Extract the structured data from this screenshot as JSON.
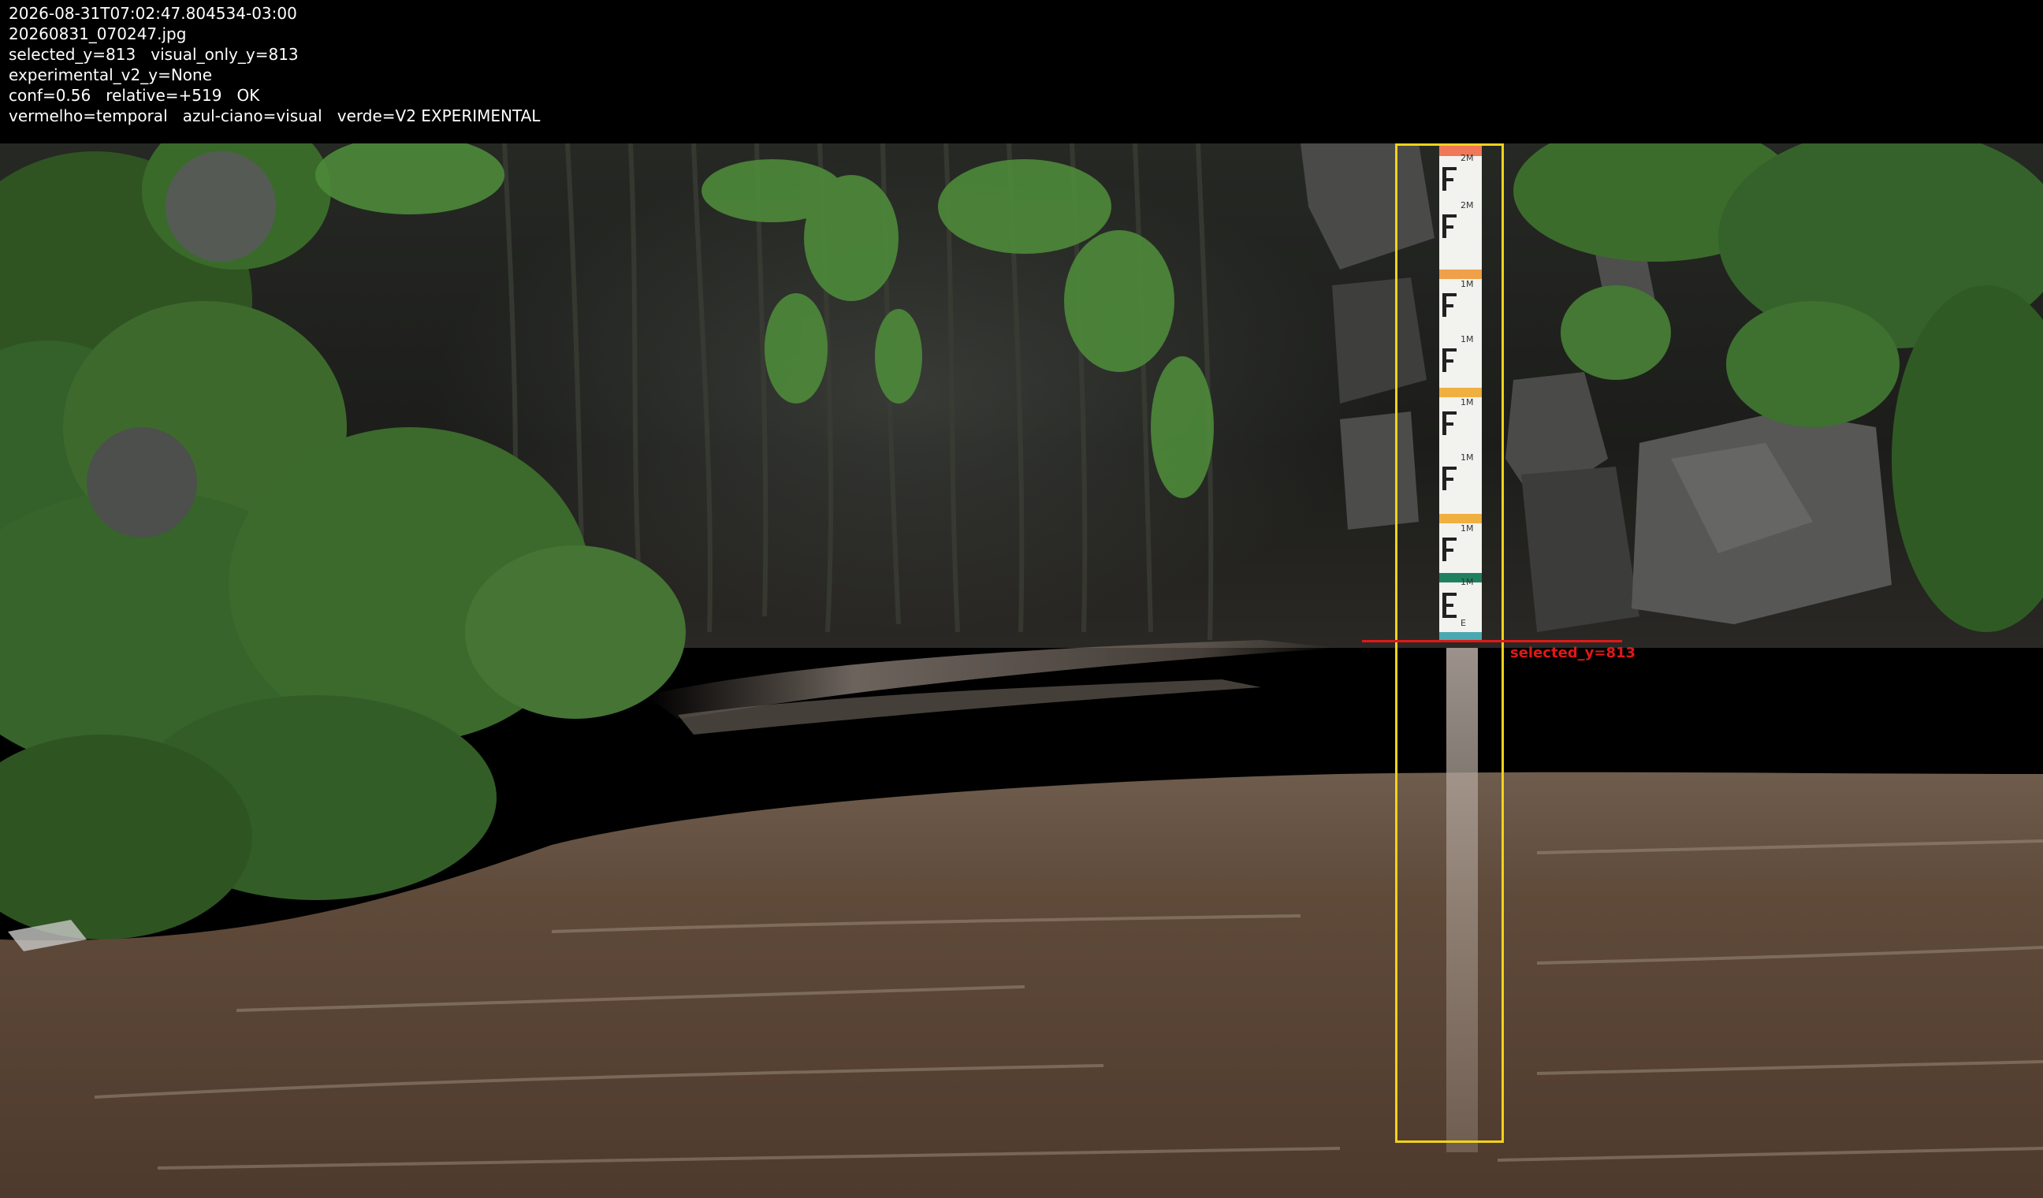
{
  "overlay": {
    "lines": [
      "2026-08-31T07:02:47.804534-03:00",
      "20260831_070247.jpg",
      "selected_y=813   visual_only_y=813",
      "experimental_v2_y=None",
      "conf=0.56   relative=+519   OK",
      "vermelho=temporal   azul-ciano=visual   verde=V2 EXPERIMENTAL"
    ]
  },
  "annotations": {
    "waterline_label": "selected_y=813",
    "roi_color": "#f2d21a",
    "waterline_color": "#e01818"
  },
  "staff_gauge": {
    "markings": [
      "2M",
      "2M",
      "1M",
      "1M",
      "1M",
      "1M",
      "1M",
      "1M",
      "E"
    ]
  },
  "colors": {
    "header_bg": "#000000",
    "header_text": "#ffffff",
    "water": "#5a4434",
    "foliage": "#3b6a2a",
    "rock": "#3a3a38"
  }
}
